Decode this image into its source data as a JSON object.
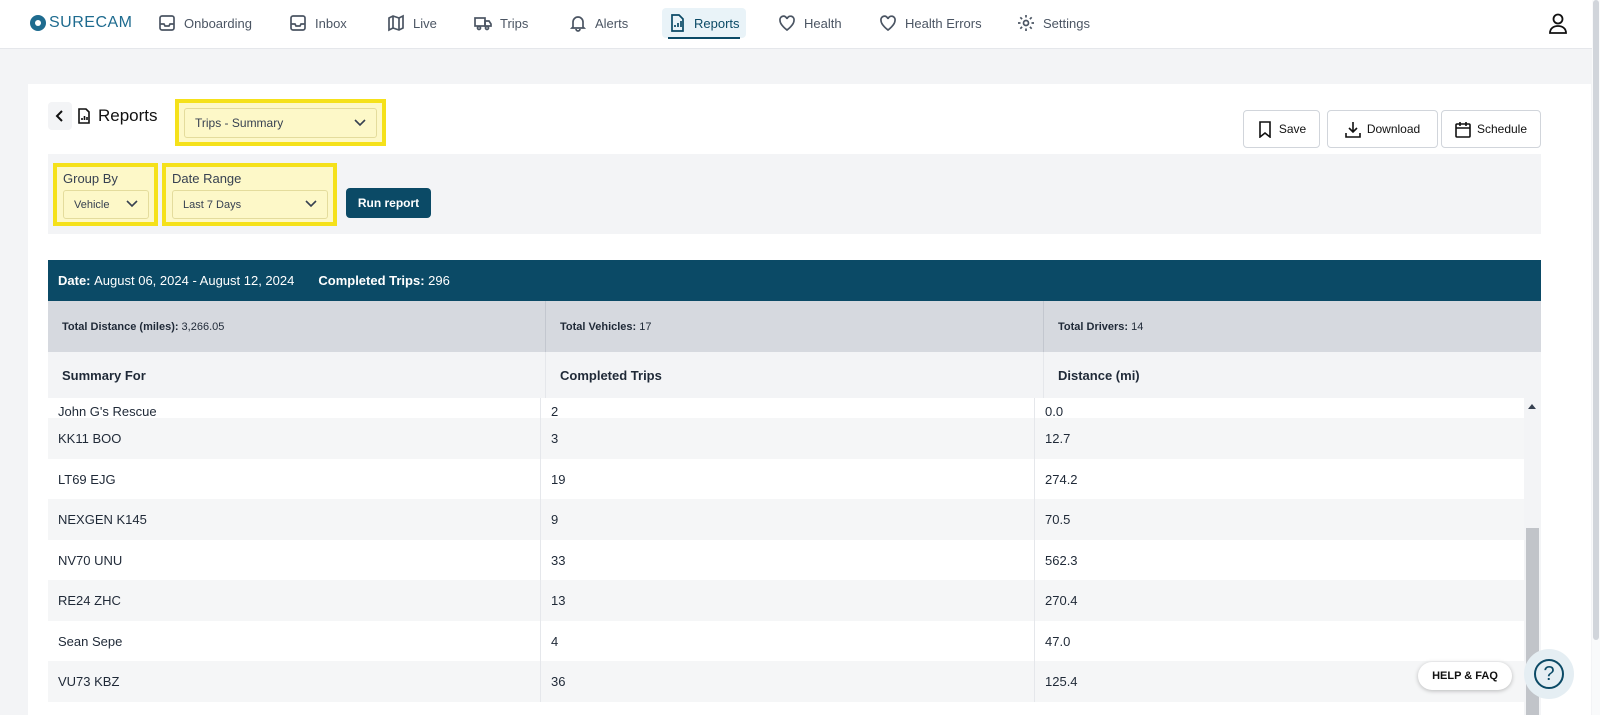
{
  "brand": {
    "name": "SURECAM",
    "primary_color": "#0b4a66",
    "highlight_color": "#f5e11a"
  },
  "nav": {
    "items": [
      {
        "label": "Onboarding",
        "icon": "inbox-icon"
      },
      {
        "label": "Inbox",
        "icon": "inbox-icon"
      },
      {
        "label": "Live",
        "icon": "map-icon"
      },
      {
        "label": "Trips",
        "icon": "truck-icon"
      },
      {
        "label": "Alerts",
        "icon": "bell-icon"
      },
      {
        "label": "Reports",
        "icon": "report-icon",
        "active": true
      },
      {
        "label": "Health",
        "icon": "heart-icon"
      },
      {
        "label": "Health Errors",
        "icon": "heart-icon"
      },
      {
        "label": "Settings",
        "icon": "gear-icon"
      }
    ],
    "user_icon": "user-icon"
  },
  "header": {
    "title": "Reports",
    "report_type": "Trips - Summary",
    "actions": {
      "save": "Save",
      "download": "Download",
      "schedule": "Schedule"
    }
  },
  "filters": {
    "group_by": {
      "label": "Group By",
      "value": "Vehicle"
    },
    "date_range": {
      "label": "Date Range",
      "value": "Last 7 Days"
    },
    "run_label": "Run report"
  },
  "summary": {
    "date_label": "Date:",
    "date_value": "August 06, 2024 - August 12, 2024",
    "trips_label": "Completed Trips:",
    "trips_value": "296",
    "totals": [
      {
        "label": "Total Distance (miles):",
        "value": "3,266.05"
      },
      {
        "label": "Total Vehicles:",
        "value": "17"
      },
      {
        "label": "Total Drivers:",
        "value": "14"
      }
    ]
  },
  "table": {
    "columns": [
      "Summary For",
      "Completed Trips",
      "Distance (mi)"
    ],
    "rows": [
      [
        "John G's Rescue",
        "2",
        "0.0"
      ],
      [
        "KK11 BOO",
        "3",
        "12.7"
      ],
      [
        "LT69 EJG",
        "19",
        "274.2"
      ],
      [
        "NEXGEN K145",
        "9",
        "70.5"
      ],
      [
        "NV70 UNU",
        "33",
        "562.3"
      ],
      [
        "RE24 ZHC",
        "13",
        "270.4"
      ],
      [
        "Sean Sepe",
        "4",
        "47.0"
      ],
      [
        "VU73 KBZ",
        "36",
        "125.4"
      ]
    ]
  },
  "help": {
    "label": "HELP & FAQ",
    "icon": "help-icon"
  }
}
